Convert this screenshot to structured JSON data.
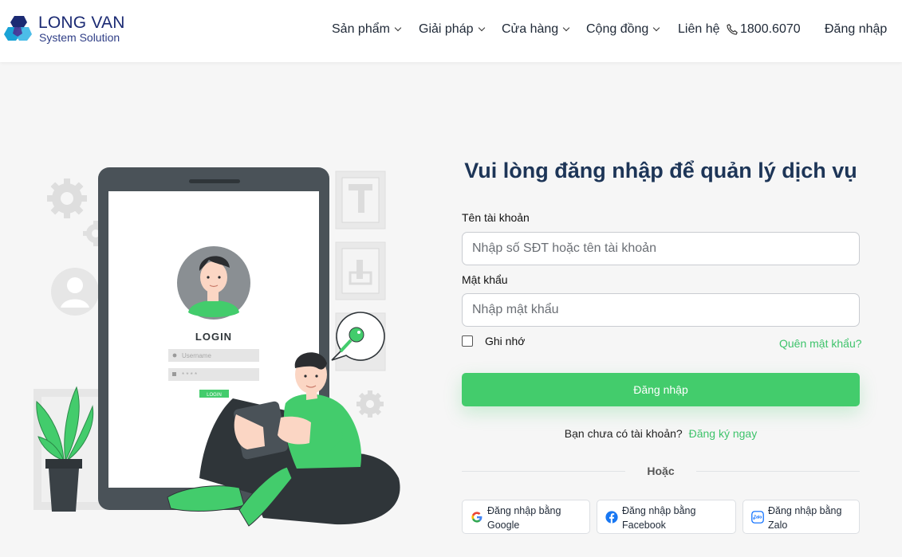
{
  "header": {
    "logo": {
      "line1": "LONG VAN",
      "line2": "System Solution"
    },
    "nav": {
      "products": "Sản phẩm",
      "solutions": "Giải pháp",
      "store": "Cửa hàng",
      "community": "Cộng đồng",
      "contact": "Liên hệ",
      "phone": "1800.6070",
      "login": "Đăng nhập"
    }
  },
  "illustration": {
    "login_title": "LOGIN",
    "username_placeholder": "Username",
    "password_mask": "* * * *",
    "login_button": "LOGIN"
  },
  "form": {
    "title": "Vui lòng đăng nhập để quản lý dịch vụ",
    "username_label": "Tên tài khoản",
    "username_placeholder": "Nhập số SĐT hoặc tên tài khoản",
    "password_label": "Mật khẩu",
    "password_placeholder": "Nhập mật khẩu",
    "remember_label": "Ghi nhớ",
    "forgot_label": "Quên mật khẩu?",
    "submit_label": "Đăng nhập",
    "no_account_text": "Bạn chưa có tài khoản?",
    "signup_label": "Đăng ký ngay",
    "or_label": "Hoặc",
    "social": [
      {
        "line1": "Đăng nhập bằng",
        "line2": "Google",
        "icon": "google-icon"
      },
      {
        "line1": "Đăng nhập bằng",
        "line2": "Facebook",
        "icon": "facebook-icon"
      },
      {
        "line1": "Đăng nhập bằng",
        "line2": "Zalo",
        "icon": "zalo-icon"
      }
    ]
  },
  "colors": {
    "accent_green": "#43cc6c",
    "title_navy": "#1d3557",
    "logo_navy": "#1b2a73"
  }
}
